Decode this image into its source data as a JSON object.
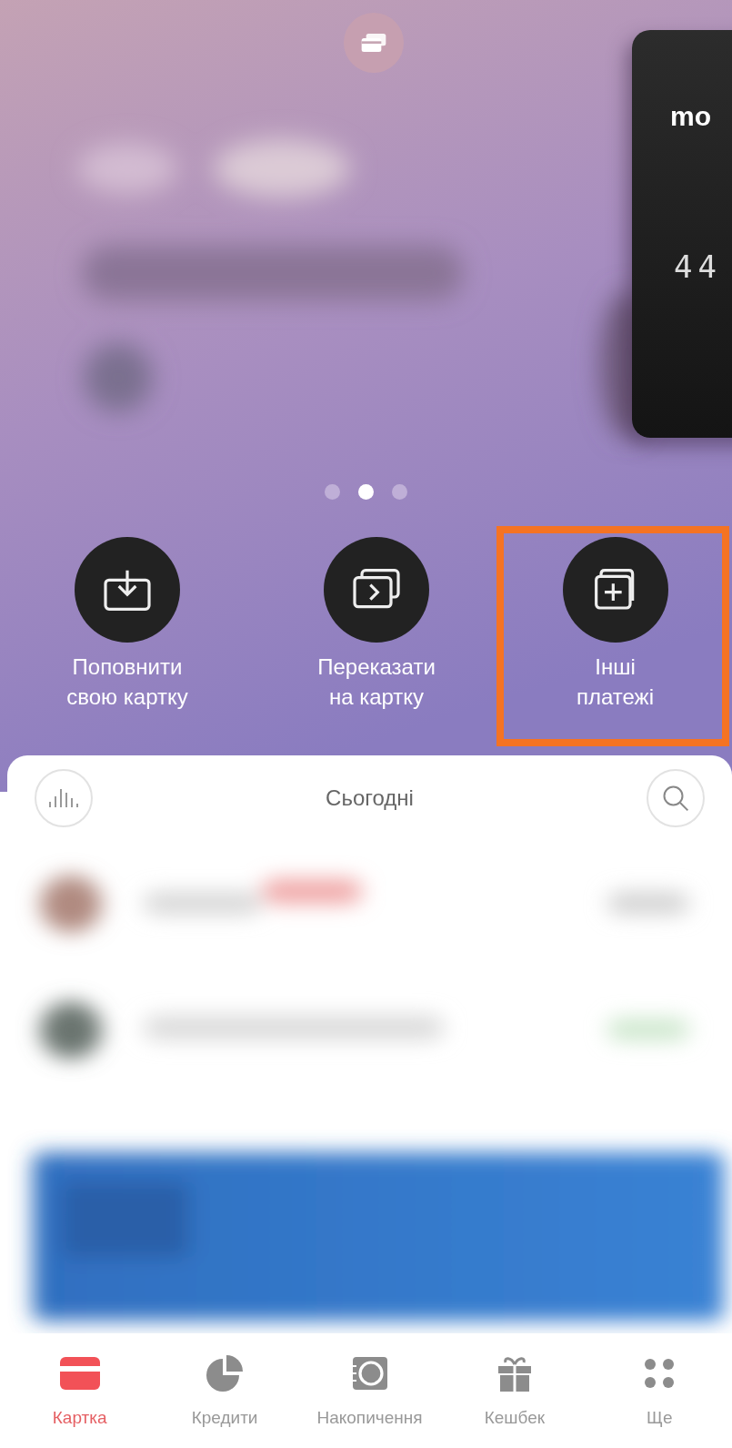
{
  "header": {
    "card": {
      "texts": [
        "mo",
        "44"
      ]
    },
    "pager": [
      {
        "selected": false
      },
      {
        "selected": true
      },
      {
        "selected": false
      }
    ]
  },
  "actions": [
    {
      "kind": "topup",
      "label": "Поповнити\nсвою картку",
      "highlighted": false
    },
    {
      "kind": "transfer",
      "label": "Переказати\nна картку",
      "highlighted": false
    },
    {
      "kind": "other",
      "label": "Інші\nплатежі",
      "highlighted": true
    }
  ],
  "feed": {
    "title": "Сьогодні"
  },
  "tab_bar": [
    {
      "kind": "card",
      "label": "Картка",
      "selected": true
    },
    {
      "kind": "credit",
      "label": "Кредити",
      "selected": false
    },
    {
      "kind": "savings",
      "label": "Накопичення",
      "selected": false
    },
    {
      "kind": "cashback",
      "label": "Кешбек",
      "selected": false
    },
    {
      "kind": "more",
      "label": "Ще",
      "selected": false
    }
  ]
}
